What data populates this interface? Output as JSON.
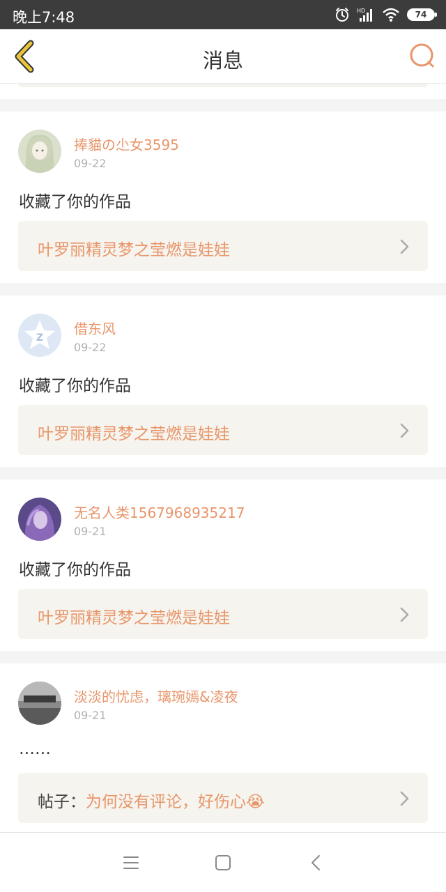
{
  "status": {
    "time": "晚上7:48",
    "battery": "74",
    "network": "HD"
  },
  "header": {
    "title": "消息"
  },
  "colors": {
    "accent": "#e8956a",
    "card_bg": "#f6f4ee",
    "back": "#e8c53a",
    "text": "#333333"
  },
  "cards": [
    {
      "user": "捧貓の尐女3595",
      "date": "09-22",
      "action": "收藏了你的作品",
      "work_title": "叶罗丽精灵梦之莹燃是娃娃",
      "avatar": "anime-girl-avatar"
    },
    {
      "user": "借东风",
      "date": "09-22",
      "action": "收藏了你的作品",
      "work_title": "叶罗丽精灵梦之莹燃是娃娃",
      "avatar": "default-star-avatar"
    },
    {
      "user": "无名人类1567968935217",
      "date": "09-21",
      "action": "收藏了你的作品",
      "work_title": "叶罗丽精灵梦之莹燃是娃娃",
      "avatar": "purple-girl-avatar"
    },
    {
      "user": "淡淡的忧虑，璃琬嫣&凌夜",
      "date": "09-21",
      "action": "……",
      "work_prefix": "帖子：",
      "work_title": "为何没有评论，好伤心😭",
      "avatar": "grey-photo-avatar"
    }
  ],
  "navbar": {
    "items": [
      "menu-icon",
      "home-icon",
      "back-icon"
    ]
  }
}
